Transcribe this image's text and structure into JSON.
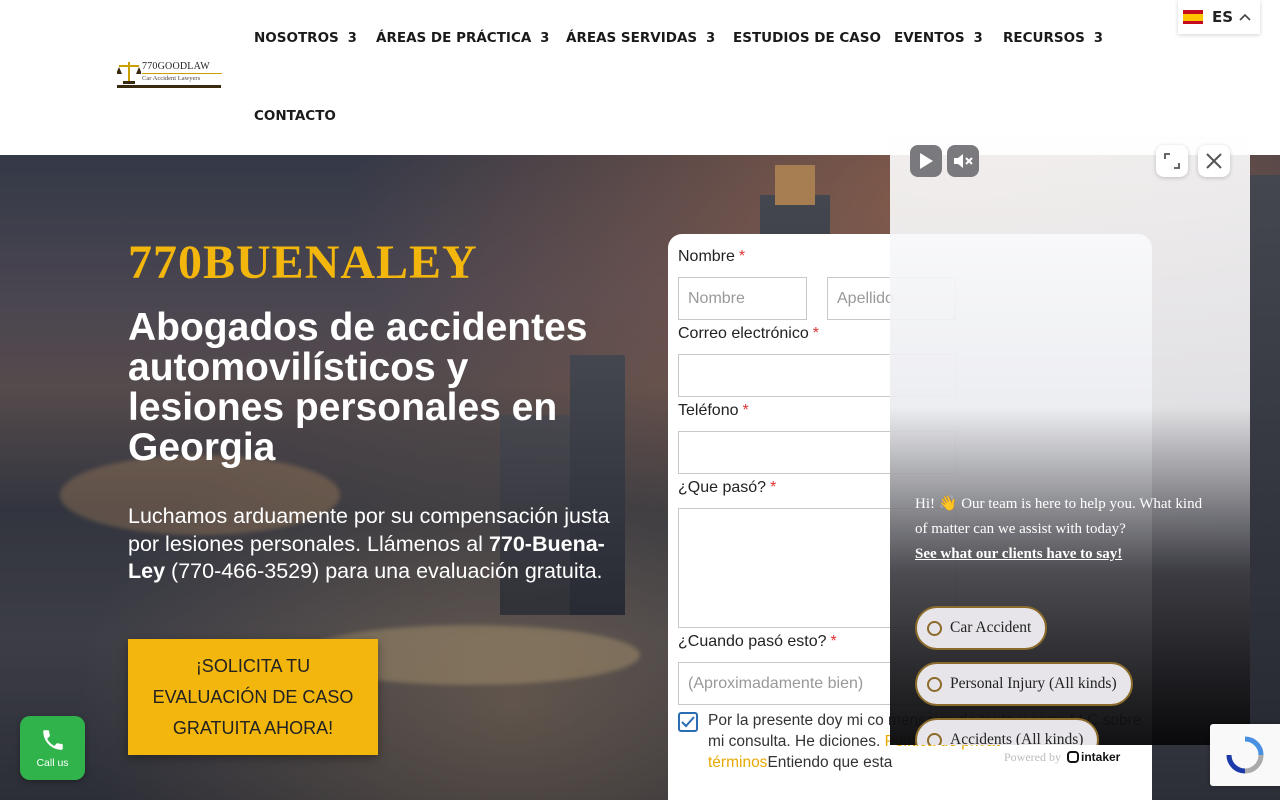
{
  "logo": {
    "text": "770GOODLAW",
    "subtitle": "Car Accident Lawyers"
  },
  "nav": {
    "items": [
      {
        "label": "NOSOTROS",
        "chevron": "3"
      },
      {
        "label": "ÁREAS DE PRÁCTICA",
        "chevron": "3"
      },
      {
        "label": "ÁREAS SERVIDAS",
        "chevron": "3"
      },
      {
        "label": "ESTUDIOS DE CASO"
      },
      {
        "label": "EVENTOS",
        "chevron": "3"
      },
      {
        "label": "RECURSOS",
        "chevron": "3"
      },
      {
        "label": "CONTACTO"
      }
    ]
  },
  "language": {
    "code": "ES",
    "flag": "spain-flag-icon"
  },
  "hero": {
    "brand": "770BUENALEY",
    "headline": "Abogados de accidentes automovilísticos y lesiones personales en Georgia",
    "lead_part1": "Luchamos arduamente por su compensación justa por lesiones personales. Llámenos al ",
    "lead_bold": "770-Buena-Ley",
    "lead_part2": " (770-466-3529) para una evaluación gratuita.",
    "cta": "¡SOLICITA TU EVALUACIÓN DE CASO GRATUITA AHORA!"
  },
  "form": {
    "name_label": "Nombre",
    "first_placeholder": "Nombre",
    "last_placeholder": "Apellido",
    "email_label": "Correo electrónico",
    "phone_label": "Teléfono",
    "what_label": "¿Que pasó?",
    "when_label": "¿Cuando pasó esto?",
    "when_placeholder": "(Aproximadamente bien)",
    "required_mark": "*",
    "consent_text": "Por la presente doy mi co mensajes de texto y corre LLC sobre mi consulta. He diciones. ",
    "consent_link": "Política de privacidad y términos",
    "consent_after": "Entiendo que esta",
    "consent_checked": true
  },
  "chat": {
    "message_pre": "Hi! ",
    "message_emoji": "👋",
    "message_post": " Our team is here to help you. What kind of matter can we assist with today?",
    "see_link": "See what our clients have to say!",
    "options": [
      "Car Accident",
      "Personal Injury (All kinds)",
      "Accidents (All kinds)"
    ],
    "powered_by": "Powered by",
    "powered_brand": "intaker"
  },
  "callus": {
    "label": "Call us"
  },
  "colors": {
    "brand_gold": "#f3b60d",
    "call_green": "#2fb34a",
    "chip_border": "#8b6a2a"
  }
}
